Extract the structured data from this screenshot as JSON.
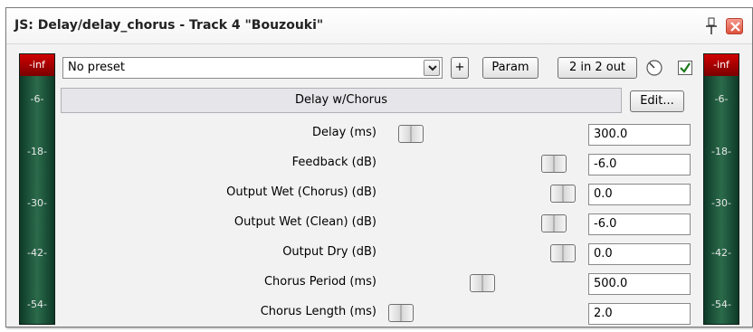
{
  "window": {
    "title": "JS: Delay/delay_chorus - Track 4 \"Bouzouki\"",
    "pin_icon": "pin-icon",
    "close_icon": "close-icon"
  },
  "meters": {
    "left": {
      "top_label": "-inf",
      "scale": [
        "-6-",
        "-18-",
        "-30-",
        "-42-",
        "-54-"
      ]
    },
    "right": {
      "top_label": "-inf",
      "scale": [
        "-6-",
        "-18-",
        "-30-",
        "-42-",
        "-54-"
      ]
    }
  },
  "toolbar": {
    "preset_value": "No preset",
    "add_label": "+",
    "param_label": "Param",
    "io_label": "2 in 2 out",
    "enabled": true
  },
  "plugin": {
    "name": "Delay w/Chorus",
    "edit_label": "Edit..."
  },
  "params": [
    {
      "label": "Delay (ms)",
      "value": "300.0"
    },
    {
      "label": "Feedback (dB)",
      "value": "-6.0"
    },
    {
      "label": "Output Wet (Chorus) (dB)",
      "value": "0.0"
    },
    {
      "label": "Output Wet (Clean) (dB)",
      "value": "-6.0"
    },
    {
      "label": "Output Dry (dB)",
      "value": "0.0"
    },
    {
      "label": "Chorus Period (ms)",
      "value": "500.0"
    },
    {
      "label": "Chorus Length (ms)",
      "value": "2.0"
    }
  ],
  "colors": {
    "meter_green": "#2b6b4b",
    "meter_red": "#d00000",
    "close_red": "#e0523d"
  }
}
